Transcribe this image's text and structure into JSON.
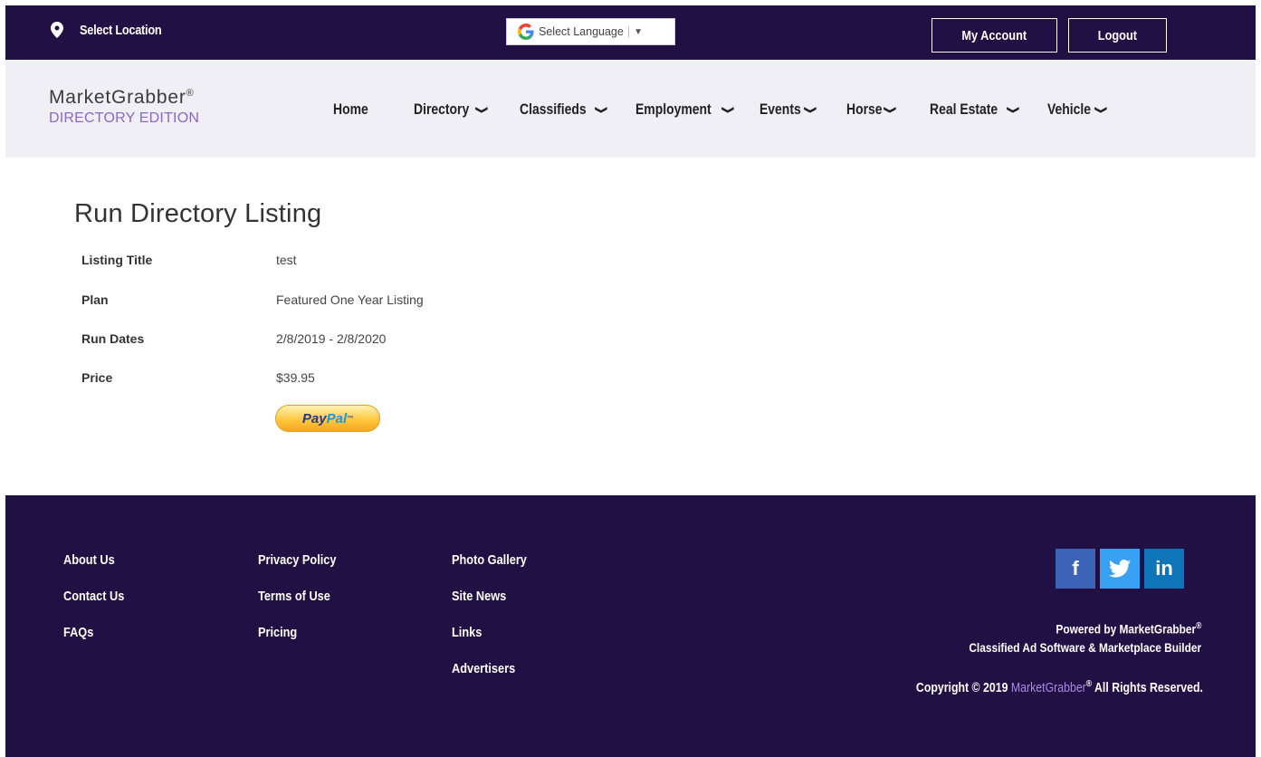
{
  "topbar": {
    "location_label": "Select Location",
    "language_label": "Select Language",
    "my_account_label": "My Account",
    "logout_label": "Logout"
  },
  "brand": {
    "name": "MarketGrabber",
    "registered": "®",
    "edition": "DIRECTORY EDITION"
  },
  "nav": {
    "items": [
      {
        "label": "Home",
        "has_dropdown": false
      },
      {
        "label": "Directory",
        "has_dropdown": true
      },
      {
        "label": "Classifieds",
        "has_dropdown": true
      },
      {
        "label": "Employment",
        "has_dropdown": true
      },
      {
        "label": "Events",
        "has_dropdown": true
      },
      {
        "label": "Horse",
        "has_dropdown": true
      },
      {
        "label": "Real Estate",
        "has_dropdown": true
      },
      {
        "label": "Vehicle",
        "has_dropdown": true
      }
    ]
  },
  "listing": {
    "title": "Run Directory Listing",
    "fields": [
      {
        "label": "Listing Title",
        "value": "test"
      },
      {
        "label": "Plan",
        "value": "Featured One Year Listing"
      },
      {
        "label": "Run Dates",
        "value": "2/8/2019 - 2/8/2020"
      },
      {
        "label": "Price",
        "value": "$39.95"
      }
    ],
    "paypal_label_pay": "Pay",
    "paypal_label_pal": "Pal",
    "paypal_tm": "™"
  },
  "footer": {
    "col1": [
      "About Us",
      "Contact Us",
      "FAQs"
    ],
    "col2": [
      "Privacy Policy",
      "Terms of Use",
      "Pricing"
    ],
    "col3": [
      "Photo Gallery",
      "Site News",
      "Links",
      "Advertisers"
    ],
    "social": {
      "facebook": "f",
      "twitter": "twitter-bird",
      "linkedin": "in"
    },
    "powered_line1": "Powered by MarketGrabber",
    "powered_line2": "Classified Ad Software & Marketplace Builder",
    "copyright_prefix": "Copyright © 2019 ",
    "copyright_brand": "MarketGrabber",
    "copyright_suffix": " All Rights Reserved."
  },
  "colors": {
    "dark_purple": "#201044",
    "header_bg": "#f0eff5",
    "accent_purple": "#8a67c8"
  }
}
